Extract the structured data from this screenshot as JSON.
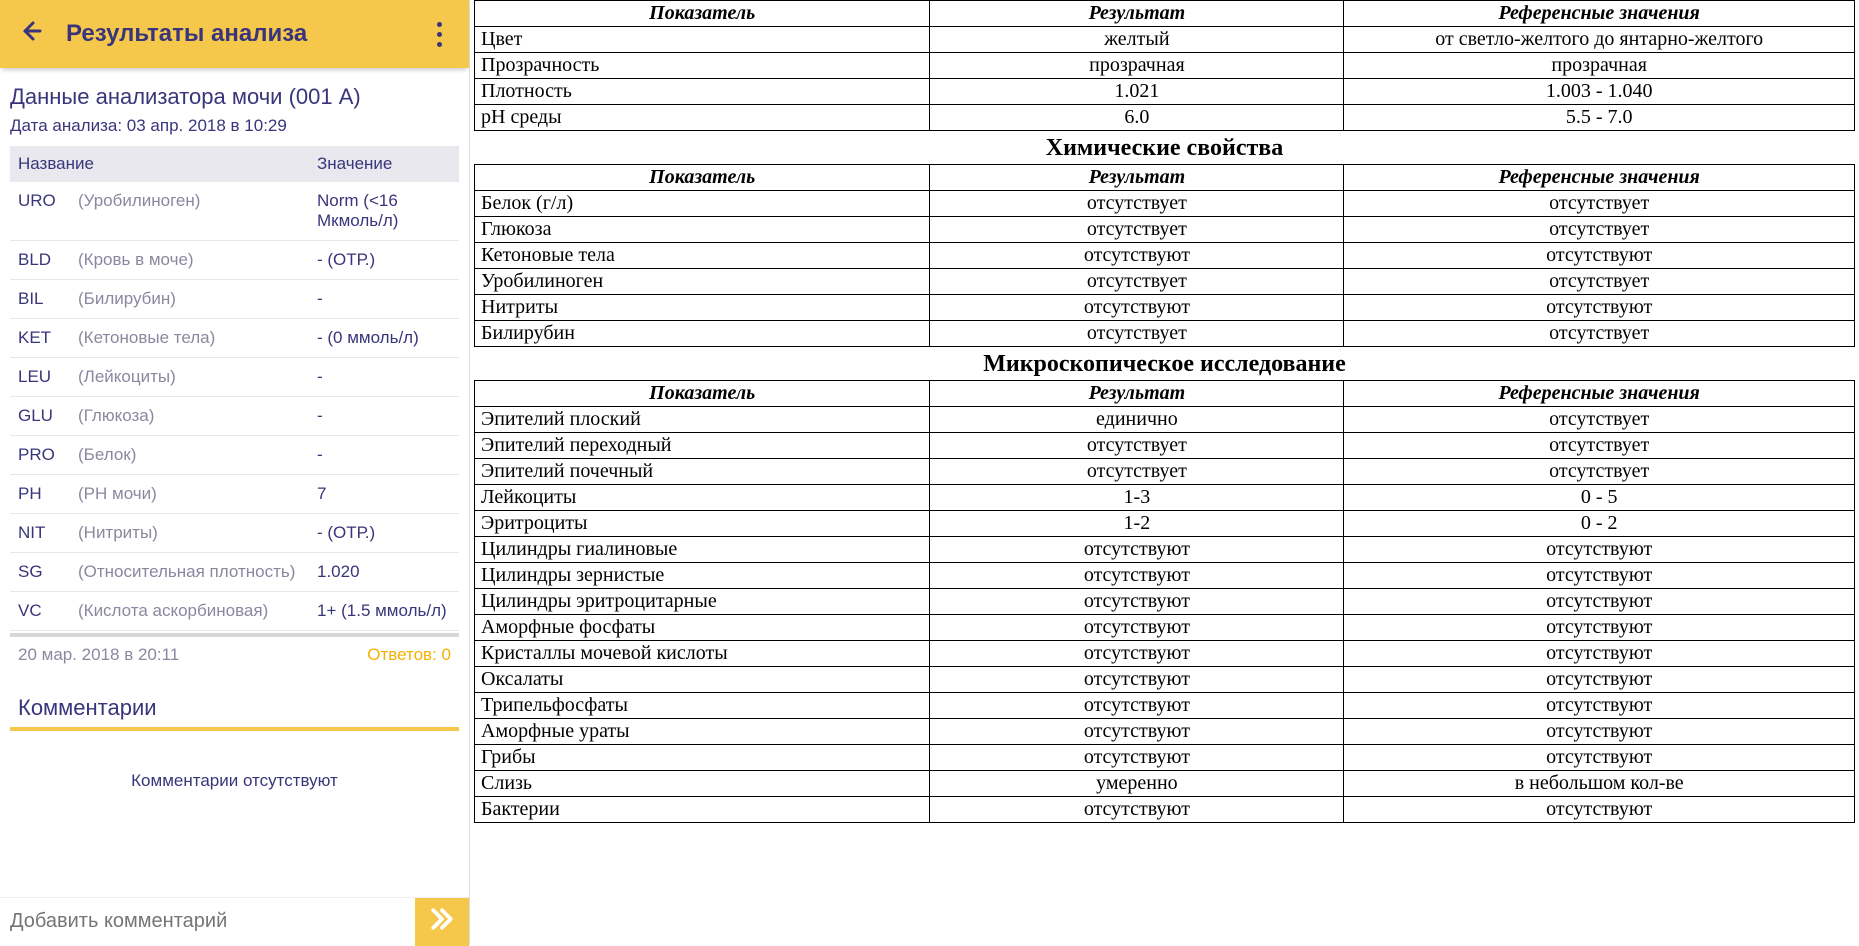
{
  "appbar": {
    "title": "Результаты анализа"
  },
  "analysis": {
    "title": "Данные анализатора мочи (001 A)",
    "date_label": "Дата анализа:",
    "date_value": "03 апр. 2018 в 10:29",
    "columns": {
      "name": "Название",
      "value": "Значение"
    },
    "rows": [
      {
        "code": "URO",
        "desc": "(Уробилиноген)",
        "value": "Norm (<16 Мкмоль/л)"
      },
      {
        "code": "BLD",
        "desc": "(Кровь в моче)",
        "value": "- (ОТР.)"
      },
      {
        "code": "BIL",
        "desc": "(Билирубин)",
        "value": "-"
      },
      {
        "code": "KET",
        "desc": "(Кетоновые тела)",
        "value": "- (0 ммоль/л)"
      },
      {
        "code": "LEU",
        "desc": "(Лейкоциты)",
        "value": "-"
      },
      {
        "code": "GLU",
        "desc": "(Глюкоза)",
        "value": "-"
      },
      {
        "code": "PRO",
        "desc": "(Белок)",
        "value": "-"
      },
      {
        "code": "PH",
        "desc": "(PH мочи)",
        "value": "7"
      },
      {
        "code": "NIT",
        "desc": "(Нитриты)",
        "value": "- (ОТР.)"
      },
      {
        "code": "SG",
        "desc": "(Относительная плотность)",
        "value": "1.020"
      },
      {
        "code": "VC",
        "desc": "(Кислота аскорбиновая)",
        "value": "1+ (1.5 ммоль/л)"
      }
    ],
    "timestamp": "20 мар. 2018 в 20:11",
    "answers_label": "Ответов: 0"
  },
  "comments": {
    "header": "Комментарии",
    "empty": "Комментарии отсутствуют",
    "placeholder": "Добавить комментарий"
  },
  "doc": {
    "columns": {
      "indicator": "Показатель",
      "result": "Результат",
      "reference": "Референсные значения"
    },
    "section1_title": "",
    "section1": [
      {
        "ind": "Цвет",
        "res": "желтый",
        "ref": "от светло-желтого до янтарно-желтого"
      },
      {
        "ind": "Прозрачность",
        "res": "прозрачная",
        "ref": "прозрачная"
      },
      {
        "ind": "Плотность",
        "res": "1.021",
        "ref": "1.003 - 1.040"
      },
      {
        "ind": "pH среды",
        "res": "6.0",
        "ref": "5.5 - 7.0"
      }
    ],
    "section2_title": "Химические свойства",
    "section2": [
      {
        "ind": "Белок (г/л)",
        "res": "отсутствует",
        "ref": "отсутствует"
      },
      {
        "ind": "Глюкоза",
        "res": "отсутствует",
        "ref": "отсутствует"
      },
      {
        "ind": "Кетоновые тела",
        "res": "отсутствуют",
        "ref": "отсутствуют"
      },
      {
        "ind": "Уробилиноген",
        "res": "отсутствует",
        "ref": "отсутствует"
      },
      {
        "ind": "Нитриты",
        "res": "отсутствуют",
        "ref": "отсутствуют"
      },
      {
        "ind": "Билирубин",
        "res": "отсутствует",
        "ref": "отсутствует"
      }
    ],
    "section3_title": "Микроскопическое исследование",
    "section3": [
      {
        "ind": "Эпителий плоский",
        "res": "единично",
        "ref": "отсутствует"
      },
      {
        "ind": "Эпителий переходный",
        "res": "отсутствует",
        "ref": "отсутствует"
      },
      {
        "ind": "Эпителий почечный",
        "res": "отсутствует",
        "ref": "отсутствует"
      },
      {
        "ind": "Лейкоциты",
        "res": "1-3",
        "ref": "0 - 5"
      },
      {
        "ind": "Эритроциты",
        "res": "1-2",
        "ref": "0 - 2"
      },
      {
        "ind": "Цилиндры гиалиновые",
        "res": "отсутствуют",
        "ref": "отсутствуют"
      },
      {
        "ind": "Цилиндры зернистые",
        "res": "отсутствуют",
        "ref": "отсутствуют"
      },
      {
        "ind": "Цилиндры эритроцитарные",
        "res": "отсутствуют",
        "ref": "отсутствуют"
      },
      {
        "ind": "Аморфные фосфаты",
        "res": "отсутствуют",
        "ref": "отсутствуют"
      },
      {
        "ind": "Кристаллы мочевой кислоты",
        "res": "отсутствуют",
        "ref": "отсутствуют"
      },
      {
        "ind": "Оксалаты",
        "res": "отсутствуют",
        "ref": "отсутствуют"
      },
      {
        "ind": "Трипельфосфаты",
        "res": "отсутствуют",
        "ref": "отсутствуют"
      },
      {
        "ind": "Аморфные ураты",
        "res": "отсутствуют",
        "ref": "отсутствуют"
      },
      {
        "ind": "Грибы",
        "res": "отсутствуют",
        "ref": "отсутствуют"
      },
      {
        "ind": "Слизь",
        "res": "умеренно",
        "ref": "в небольшом кол-ве"
      },
      {
        "ind": "Бактерии",
        "res": "отсутствуют",
        "ref": "отсутствуют"
      }
    ]
  }
}
